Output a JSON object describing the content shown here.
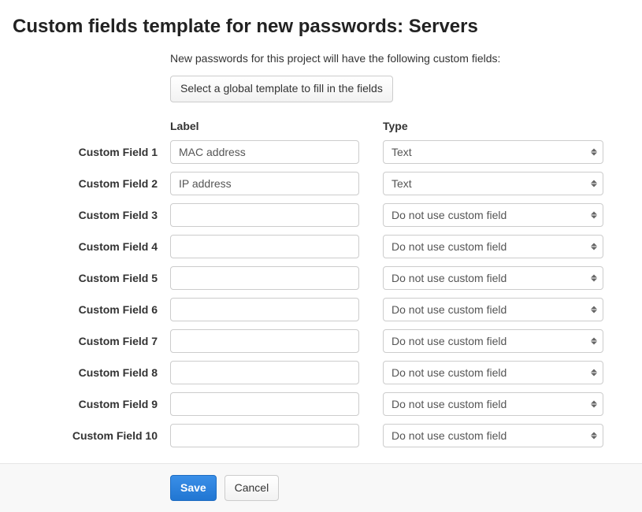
{
  "title": "Custom fields template for new passwords: Servers",
  "intro": "New passwords for this project will have the following custom fields:",
  "global_template_button": "Select a global template to fill in the fields",
  "columns": {
    "label": "Label",
    "type": "Type"
  },
  "type_options": [
    "Text",
    "Do not use custom field"
  ],
  "fields": [
    {
      "name": "Custom Field 1",
      "label": "MAC address",
      "type": "Text"
    },
    {
      "name": "Custom Field 2",
      "label": "IP address",
      "type": "Text"
    },
    {
      "name": "Custom Field 3",
      "label": "",
      "type": "Do not use custom field"
    },
    {
      "name": "Custom Field 4",
      "label": "",
      "type": "Do not use custom field"
    },
    {
      "name": "Custom Field 5",
      "label": "",
      "type": "Do not use custom field"
    },
    {
      "name": "Custom Field 6",
      "label": "",
      "type": "Do not use custom field"
    },
    {
      "name": "Custom Field 7",
      "label": "",
      "type": "Do not use custom field"
    },
    {
      "name": "Custom Field 8",
      "label": "",
      "type": "Do not use custom field"
    },
    {
      "name": "Custom Field 9",
      "label": "",
      "type": "Do not use custom field"
    },
    {
      "name": "Custom Field 10",
      "label": "",
      "type": "Do not use custom field"
    }
  ],
  "footer": {
    "save": "Save",
    "cancel": "Cancel"
  }
}
